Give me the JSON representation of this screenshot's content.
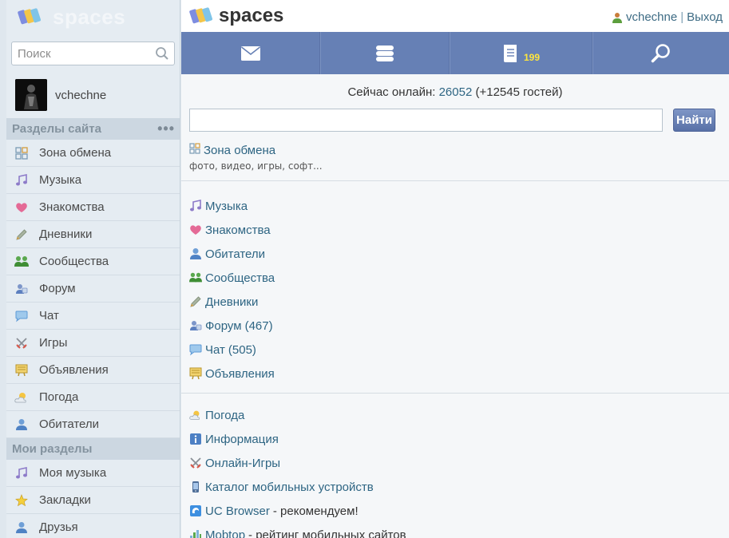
{
  "sidebar": {
    "logo_text": "spaces",
    "search_placeholder": "Поиск",
    "user_name": "vchechne",
    "section_site": "Разделы сайта",
    "section_more": "•••",
    "site_items": [
      {
        "label": "Зона обмена",
        "icon": "grid-icon"
      },
      {
        "label": "Музыка",
        "icon": "music-note-icon"
      },
      {
        "label": "Знакомства",
        "icon": "heart-icon"
      },
      {
        "label": "Дневники",
        "icon": "pencil-icon"
      },
      {
        "label": "Сообщества",
        "icon": "group-icon"
      },
      {
        "label": "Форум",
        "icon": "forum-icon"
      },
      {
        "label": "Чат",
        "icon": "chat-bubble-icon"
      },
      {
        "label": "Игры",
        "icon": "crossed-swords-icon"
      },
      {
        "label": "Объявления",
        "icon": "board-icon"
      },
      {
        "label": "Погода",
        "icon": "weather-icon"
      },
      {
        "label": "Обитатели",
        "icon": "person-icon"
      }
    ],
    "section_mine": "Мои разделы",
    "my_items": [
      {
        "label": "Моя музыка",
        "icon": "music-note-icon"
      },
      {
        "label": "Закладки",
        "icon": "star-icon"
      },
      {
        "label": "Друзья",
        "icon": "person-icon"
      }
    ]
  },
  "topbar": {
    "logo_text": "spaces",
    "user_link": "vchechne",
    "separator": "|",
    "logout": "Выход"
  },
  "navbar": {
    "mail_icon": "mail-icon",
    "feed_icon": "feed-icon",
    "journal_icon": "journal-icon",
    "journal_count": "199",
    "search_icon": "search-icon"
  },
  "main": {
    "online_prefix": "Сейчас онлайн:",
    "online_count": "26052",
    "online_guests": "(+12545 гостей)",
    "search_button": "Найти",
    "zona_label": "Зона обмена",
    "zona_sub": "фото, видео, игры, софт...",
    "group1": [
      {
        "label": "Музыка",
        "count": "",
        "icon": "music-note-icon"
      },
      {
        "label": "Знакомства",
        "count": "",
        "icon": "heart-icon"
      },
      {
        "label": "Обитатели",
        "count": "",
        "icon": "person-icon"
      },
      {
        "label": "Сообщества",
        "count": "",
        "icon": "group-icon"
      },
      {
        "label": "Дневники",
        "count": "",
        "icon": "pencil-icon"
      },
      {
        "label": "Форум",
        "count": "(467)",
        "icon": "forum-icon"
      },
      {
        "label": "Чат",
        "count": "(505)",
        "icon": "chat-bubble-icon"
      },
      {
        "label": "Объявления",
        "count": "",
        "icon": "board-icon"
      }
    ],
    "group2": [
      {
        "label": "Погода",
        "suffix": "",
        "icon": "weather-icon"
      },
      {
        "label": "Информация",
        "suffix": "",
        "icon": "info-icon"
      },
      {
        "label": "Онлайн-Игры",
        "suffix": "",
        "icon": "crossed-swords-icon"
      },
      {
        "label": "Каталог мобильных устройств",
        "suffix": "",
        "icon": "phone-icon"
      },
      {
        "label": "UC Browser",
        "suffix": "- рекомендуем!",
        "icon": "uc-browser-icon"
      },
      {
        "label": "Mobtop",
        "suffix": "- рейтинг мобильных сайтов",
        "icon": "bar-chart-icon"
      }
    ]
  }
}
